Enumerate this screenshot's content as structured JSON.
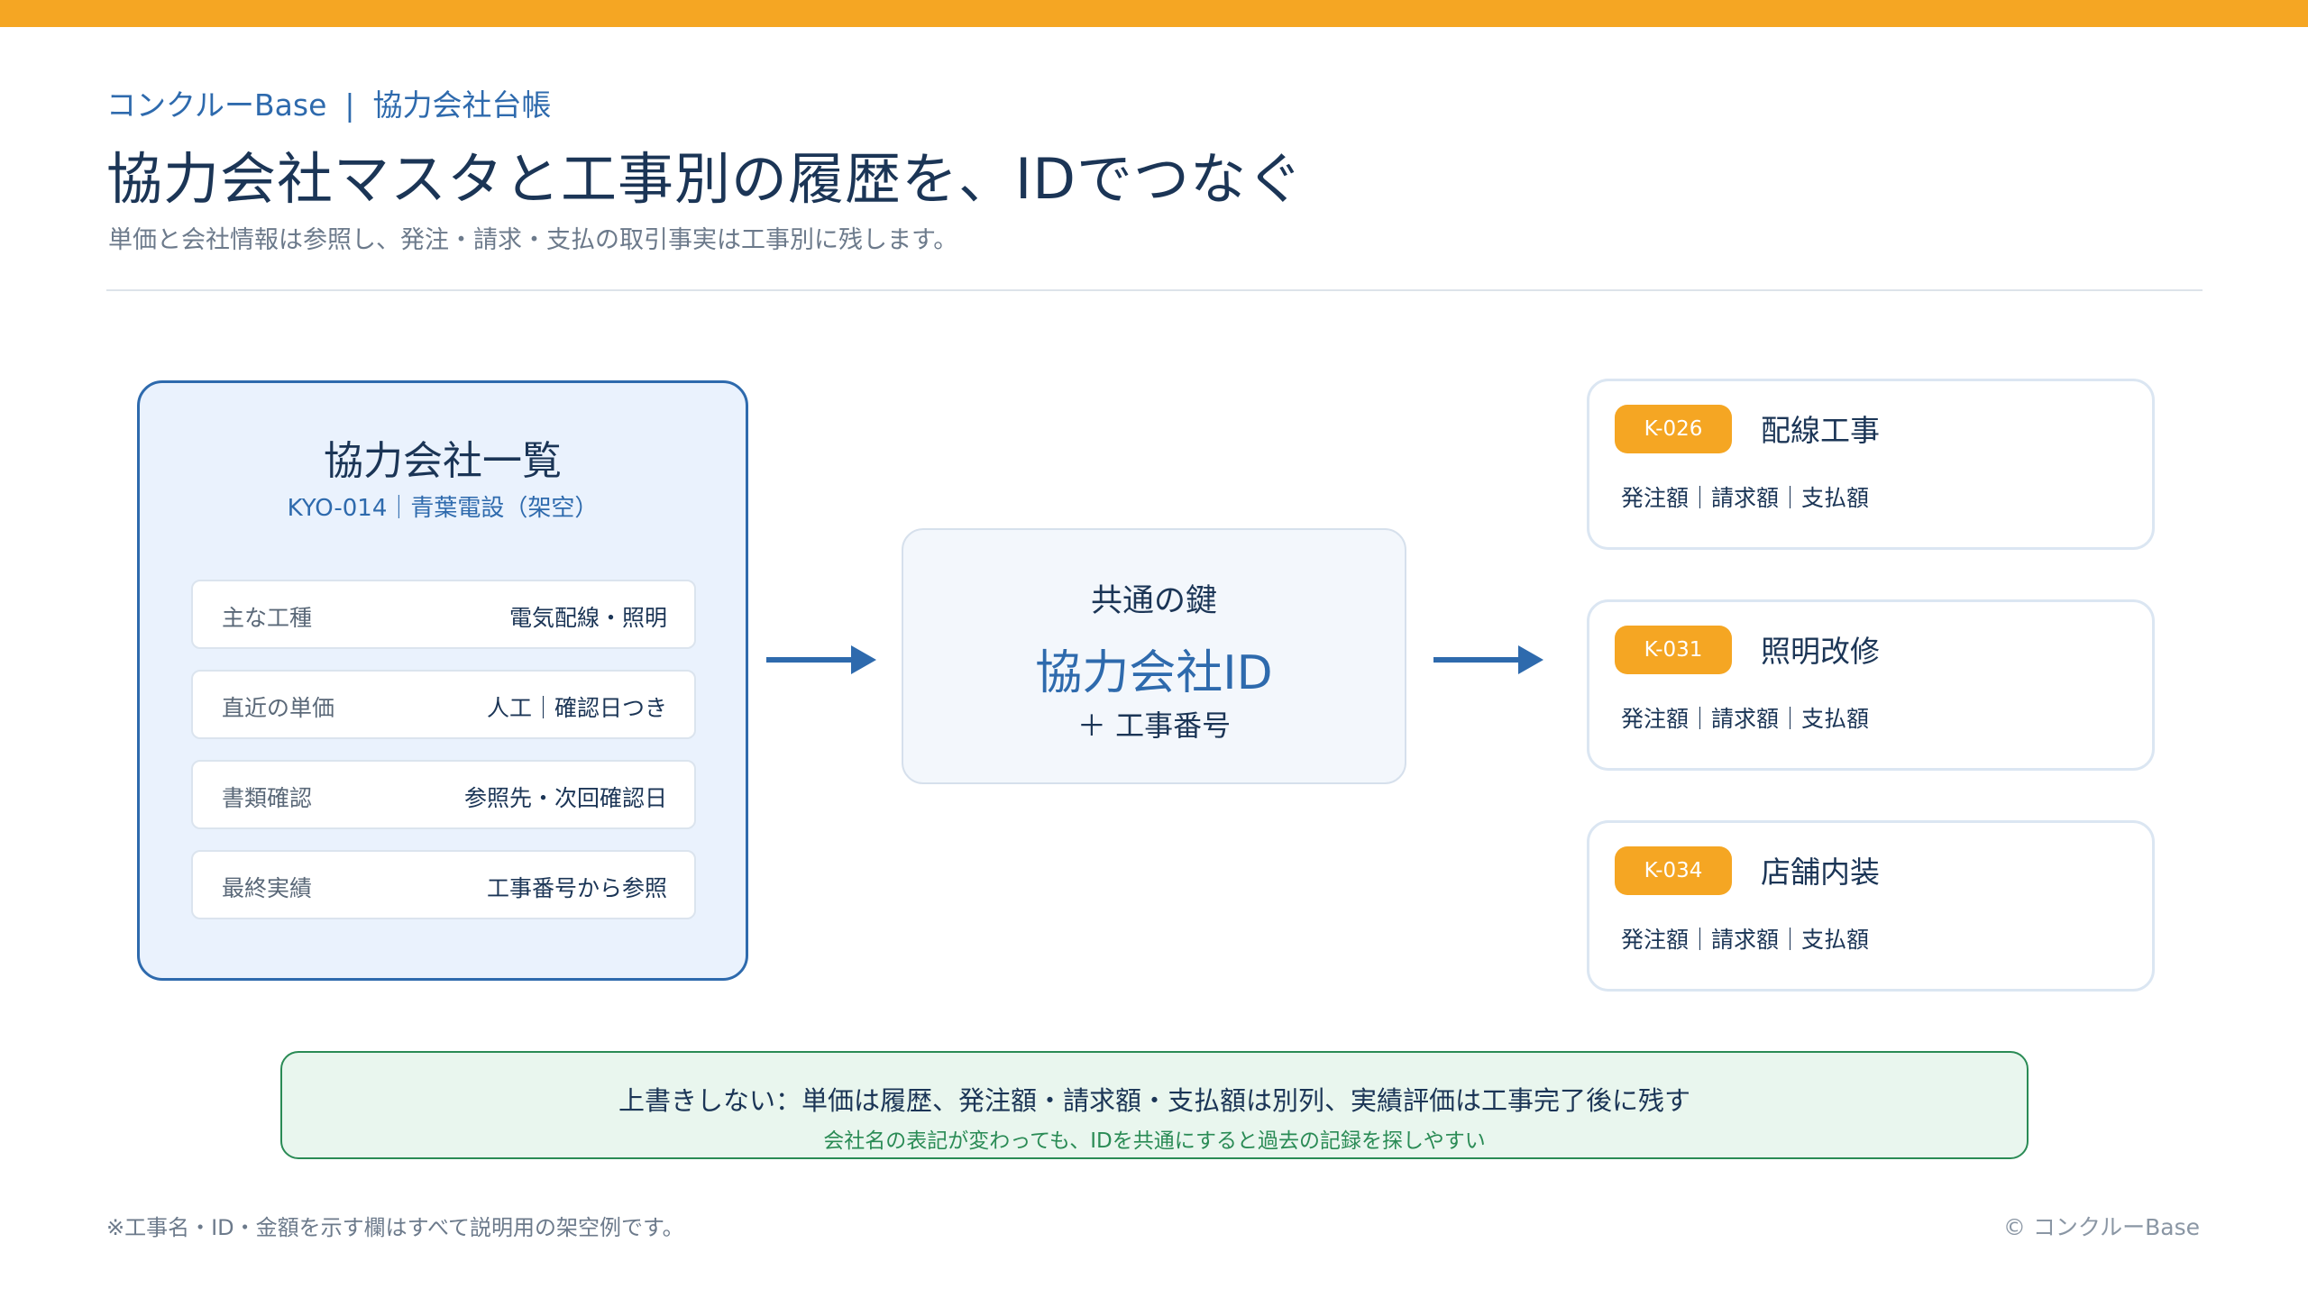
{
  "breadcrumb": {
    "app": "コンクルーBase",
    "separator": "|",
    "section": "協力会社台帳"
  },
  "title": "協力会社マスタと工事別の履歴を、IDでつなぐ",
  "subtitle": "単価と会社情報は参照し、発注・請求・支払の取引事実は工事別に残します。",
  "master": {
    "title": "協力会社一覧",
    "subtitle": "KYO-014｜青葉電設（架空）",
    "rows": [
      {
        "label": "主な工種",
        "value": "電気配線・照明"
      },
      {
        "label": "直近の単価",
        "value": "人工｜確認日つき"
      },
      {
        "label": "書類確認",
        "value": "参照先・次回確認日"
      },
      {
        "label": "最終実績",
        "value": "工事番号から参照"
      }
    ]
  },
  "key": {
    "label": "共通の鍵",
    "main": "協力会社ID",
    "plus": "＋ 工事番号"
  },
  "projects": [
    {
      "id": "K-026",
      "name": "配線工事",
      "fields": "発注額｜請求額｜支払額"
    },
    {
      "id": "K-031",
      "name": "照明改修",
      "fields": "発注額｜請求額｜支払額"
    },
    {
      "id": "K-034",
      "name": "店舗内装",
      "fields": "発注額｜請求額｜支払額"
    }
  ],
  "note": {
    "main": "上書きしない：単価は履歴、発注額・請求額・支払額は別列、実績評価は工事完了後に残す",
    "sub": "会社名の表記が変わっても、IDを共通にすると過去の記録を探しやすい"
  },
  "footnote": "※工事名・ID・金額を示す欄はすべて説明用の架空例です。",
  "copyright": "© コンクルーBase",
  "colors": {
    "accent": "#f5a623",
    "primary": "#2e6aad",
    "success": "#2a8b55",
    "text": "#1b3556"
  }
}
